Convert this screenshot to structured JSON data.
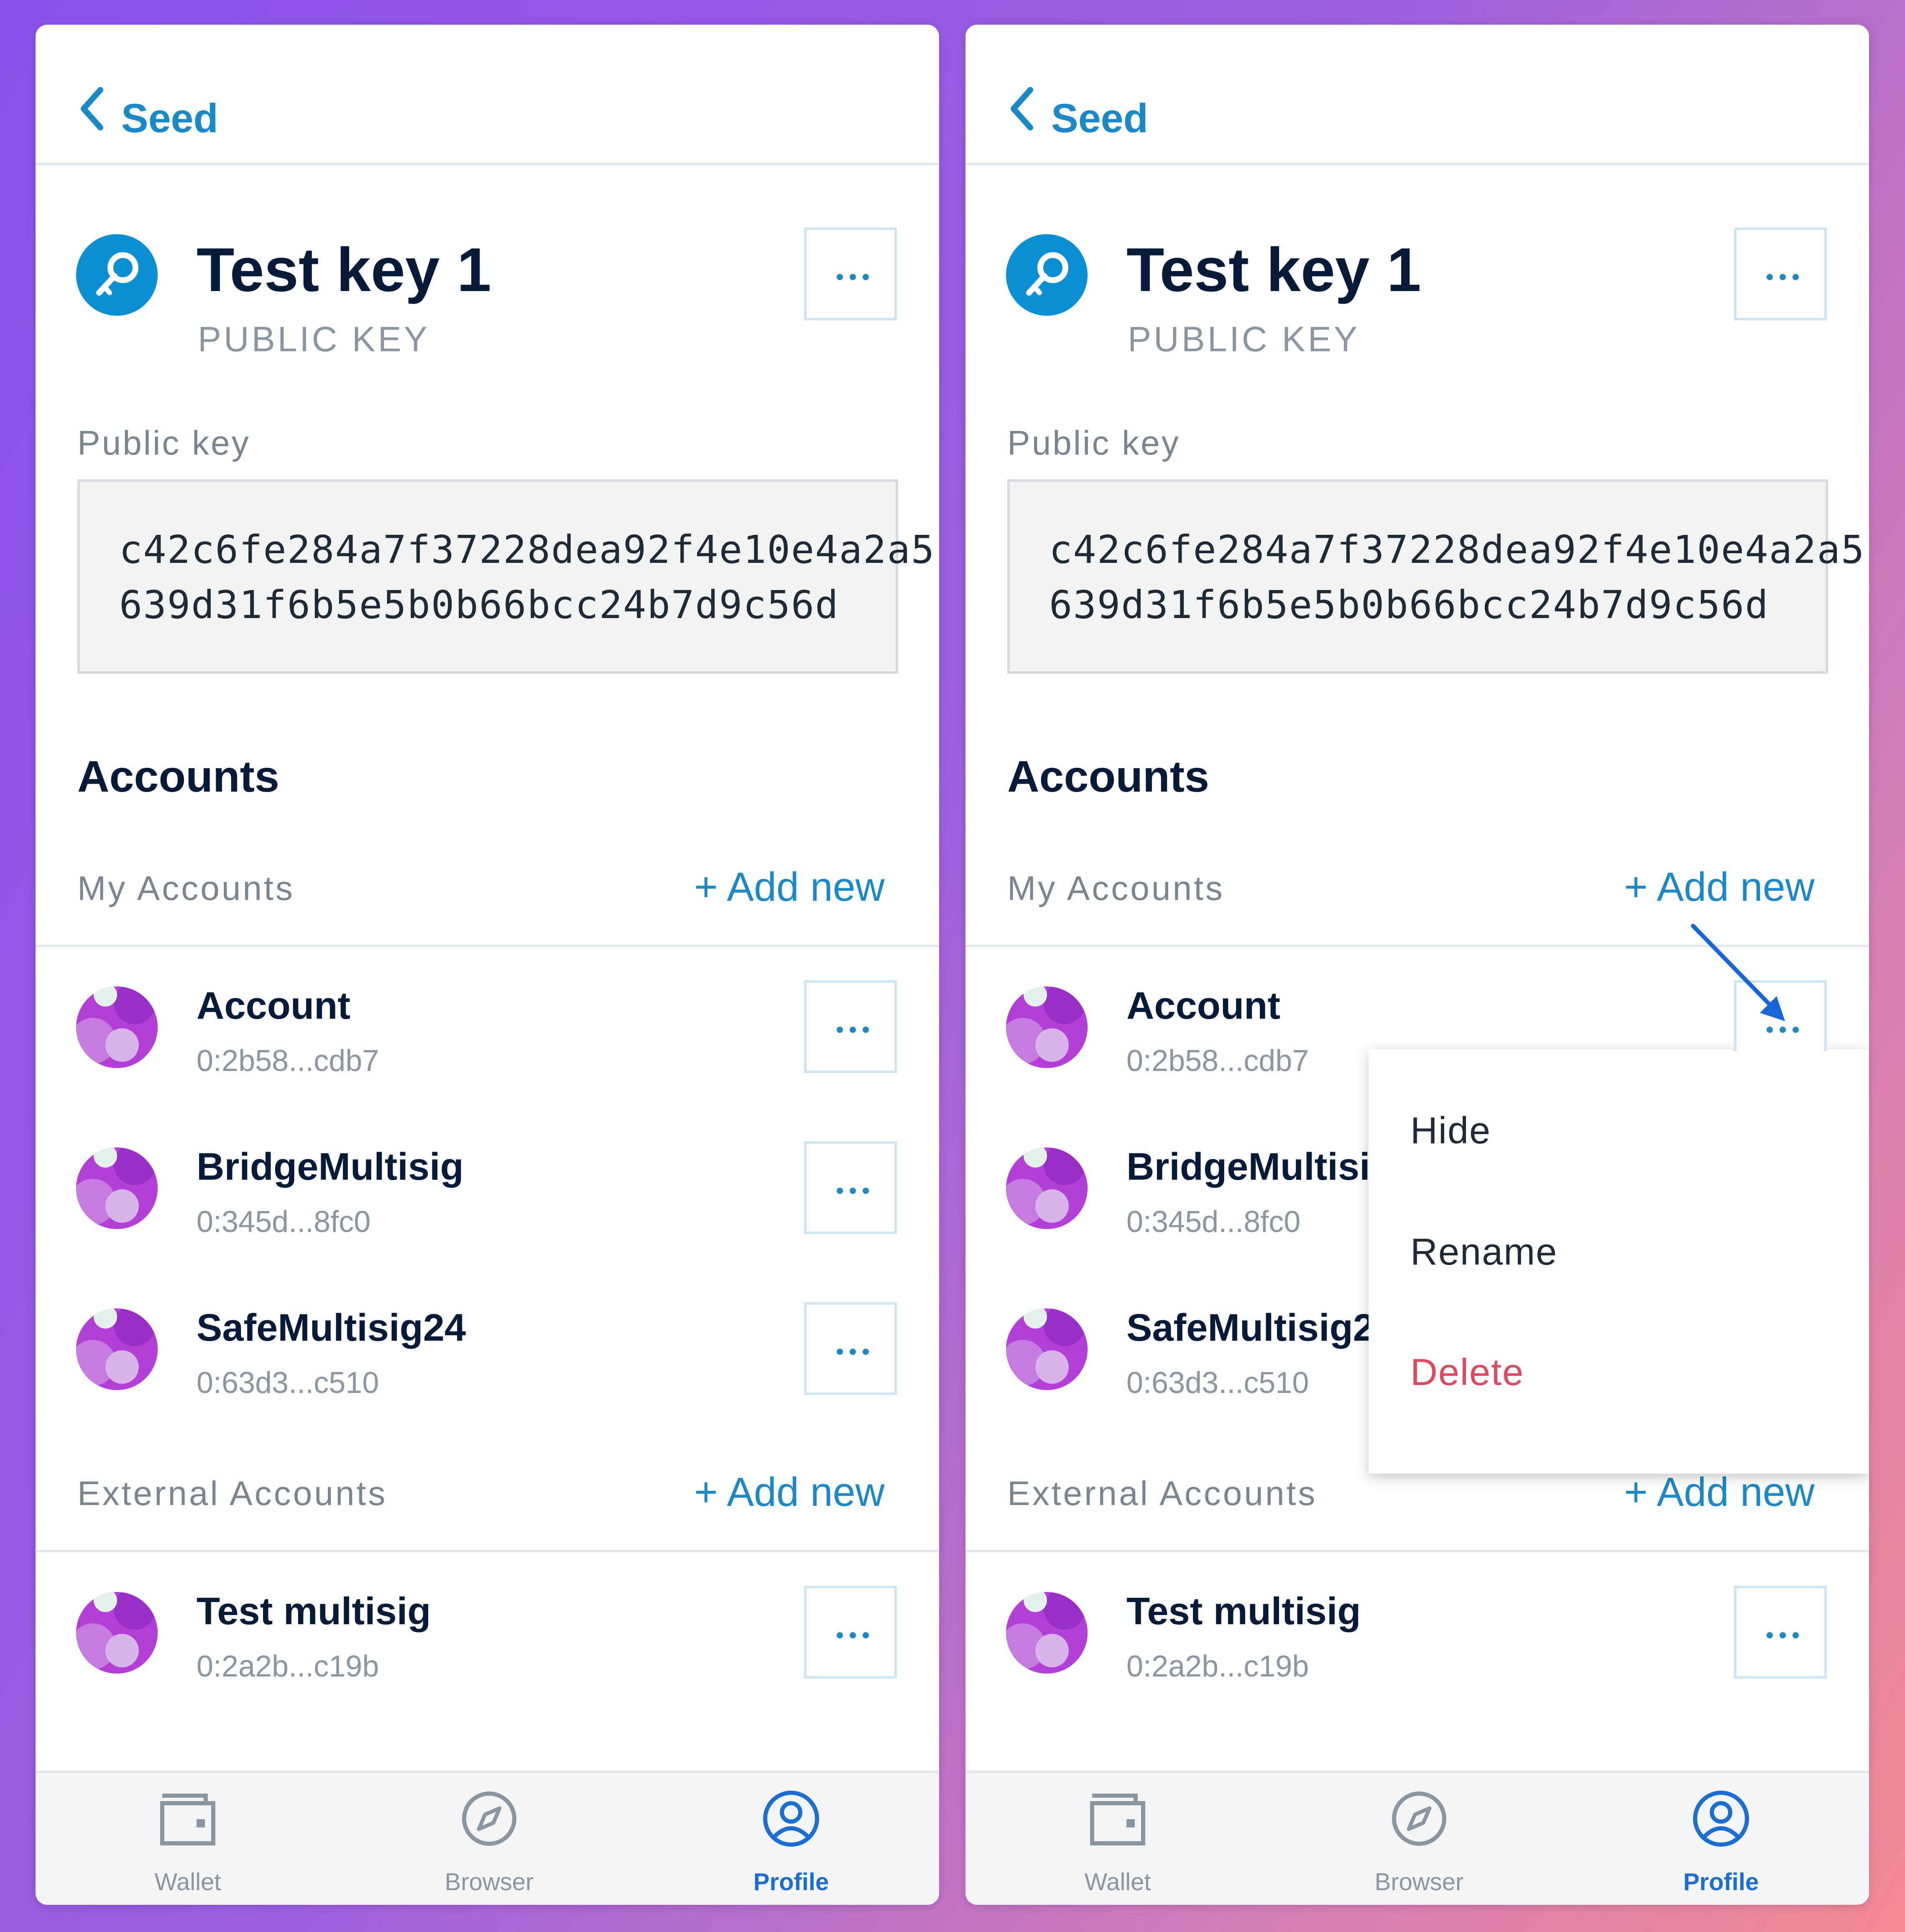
{
  "header": {
    "back_label": "Seed"
  },
  "key": {
    "title": "Test key 1",
    "subtitle": "PUBLIC KEY"
  },
  "public_key": {
    "label": "Public key",
    "line1": "c42c6fe284a7f37228dea92f4e10e4a2a5",
    "line2": "639d31f6b5e5b0b66bcc24b7d9c56d"
  },
  "accounts": {
    "title": "Accounts",
    "my_label": "My Accounts",
    "external_label": "External Accounts",
    "add_new": "+ Add new",
    "my": [
      {
        "name": "Account",
        "address": "0:2b58...cdb7"
      },
      {
        "name": "BridgeMultisig",
        "address": "0:345d...8fc0"
      },
      {
        "name": "SafeMultisig24",
        "address": "0:63d3...c510"
      }
    ],
    "external": [
      {
        "name": "Test multisig",
        "address": "0:2a2b...c19b"
      }
    ]
  },
  "menu": {
    "hide": "Hide",
    "rename": "Rename",
    "delete": "Delete"
  },
  "tabs": [
    {
      "label": "Wallet",
      "icon": "wallet-icon"
    },
    {
      "label": "Browser",
      "icon": "compass-icon"
    },
    {
      "label": "Profile",
      "icon": "profile-icon"
    }
  ],
  "colors": {
    "accent": "#1b89c8",
    "active_tab": "#1b6fd4",
    "danger": "#e0485f",
    "title": "#061b3a"
  }
}
